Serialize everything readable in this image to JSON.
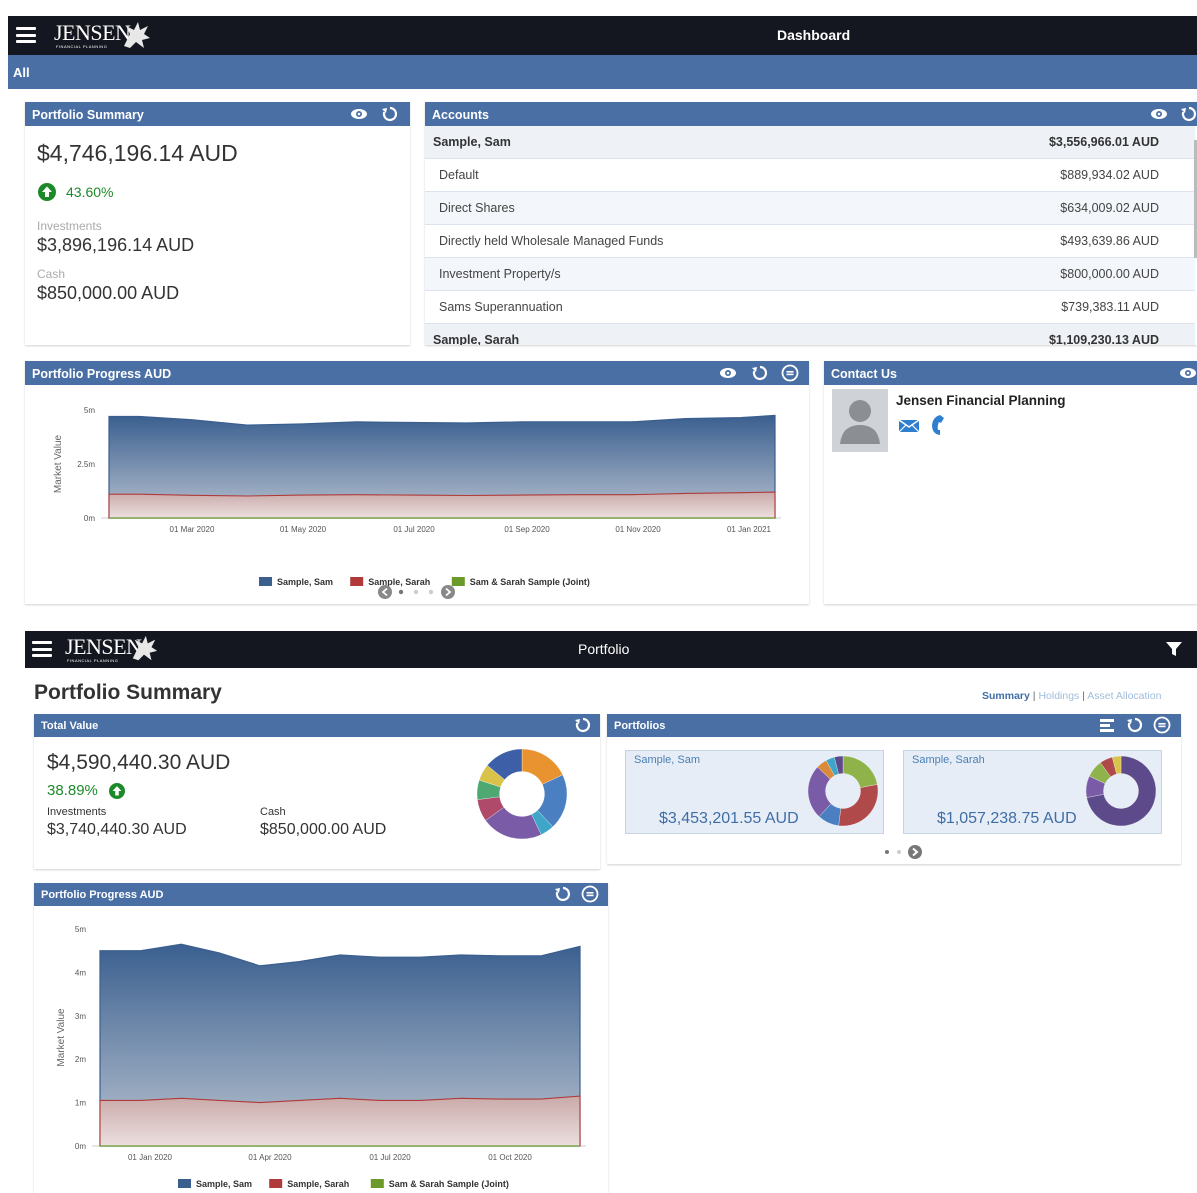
{
  "colors": {
    "topbar": "#14171f",
    "blue_bar": "#4a6fa5",
    "up_green": "#1d8a2a",
    "sam": "#3a5f8f",
    "sarah": "#b03a3a",
    "joint": "#6b9a2a"
  },
  "dashboard": {
    "logo": {
      "main": "JENSEN",
      "sub": "FINANCIAL PLANNING"
    },
    "title": "Dashboard",
    "filter_label": "All",
    "portfolio_summary": {
      "title": "Portfolio Summary",
      "total": "$4,746,196.14 AUD",
      "change": "43.60%",
      "investments_label": "Investments",
      "investments": "$3,896,196.14 AUD",
      "cash_label": "Cash",
      "cash": "$850,000.00 AUD"
    },
    "accounts": {
      "title": "Accounts",
      "rows": [
        {
          "name": "Sample, Sam",
          "value": "$3,556,966.01 AUD",
          "group": true
        },
        {
          "name": "Default",
          "value": "$889,934.02 AUD",
          "group": false
        },
        {
          "name": "Direct Shares",
          "value": "$634,009.02 AUD",
          "group": false
        },
        {
          "name": "Directly held Wholesale Managed Funds",
          "value": "$493,639.86 AUD",
          "group": false
        },
        {
          "name": "Investment Property/s",
          "value": "$800,000.00 AUD",
          "group": false
        },
        {
          "name": "Sams Superannuation",
          "value": "$739,383.11 AUD",
          "group": false
        },
        {
          "name": "Sample, Sarah",
          "value": "$1,109,230.13 AUD",
          "group": true
        }
      ]
    },
    "contact": {
      "title": "Contact Us",
      "name": "Jensen Financial Planning"
    },
    "chart_panel_title": "Portfolio Progress AUD"
  },
  "portfolio": {
    "title": "Portfolio",
    "page_title": "Portfolio Summary",
    "nav": {
      "summary": "Summary",
      "sep1": "|",
      "holdings": "Holdings",
      "sep2": "|",
      "allocation": "Asset Allocation"
    },
    "total_value": {
      "title": "Total Value",
      "total": "$4,590,440.30 AUD",
      "change": "38.89%",
      "investments_label": "Investments",
      "investments": "$3,740,440.30 AUD",
      "cash_label": "Cash",
      "cash": "$850,000.00 AUD"
    },
    "portfolios": {
      "title": "Portfolios",
      "cards": [
        {
          "name": "Sample, Sam",
          "value": "$3,453,201.55 AUD"
        },
        {
          "name": "Sample, Sarah",
          "value": "$1,057,238.75 AUD"
        }
      ]
    },
    "chart_panel_title": "Portfolio Progress AUD"
  },
  "chart_data": [
    {
      "type": "area",
      "ylabel": "Market Value",
      "xlabel": "",
      "yticks": [
        "0m",
        "2.5m",
        "5m"
      ],
      "ylim": [
        0,
        5
      ],
      "x_tick_labels": [
        "01 Mar 2020",
        "01 May 2020",
        "01 Jul 2020",
        "01 Sep 2020",
        "01 Nov 2020",
        "01 Jan 2021"
      ],
      "x": [
        "2020-01-15",
        "2020-02-01",
        "2020-03-01",
        "2020-04-01",
        "2020-05-01",
        "2020-06-01",
        "2020-07-01",
        "2020-08-01",
        "2020-09-01",
        "2020-10-01",
        "2020-11-01",
        "2020-12-01",
        "2021-01-01",
        "2021-01-20"
      ],
      "series": [
        {
          "name": "Sample, Sam",
          "values": [
            4.7,
            4.7,
            4.55,
            4.3,
            4.35,
            4.45,
            4.42,
            4.4,
            4.45,
            4.45,
            4.45,
            4.6,
            4.65,
            4.75
          ]
        },
        {
          "name": "Sample, Sarah",
          "values": [
            1.1,
            1.1,
            1.05,
            1.02,
            1.06,
            1.08,
            1.06,
            1.04,
            1.06,
            1.08,
            1.08,
            1.14,
            1.17,
            1.2
          ]
        },
        {
          "name": "Sam & Sarah Sample (Joint)",
          "values": [
            0,
            0,
            0,
            0,
            0,
            0,
            0,
            0,
            0,
            0,
            0,
            0,
            0,
            0
          ]
        }
      ],
      "legend": "bottom",
      "grid": false
    },
    {
      "type": "area",
      "ylabel": "Market Value",
      "xlabel": "",
      "yticks": [
        "0m",
        "1m",
        "2m",
        "3m",
        "4m",
        "5m"
      ],
      "ylim": [
        0,
        5
      ],
      "x_tick_labels": [
        "01 Jan 2020",
        "01 Apr 2020",
        "01 Jul 2020",
        "01 Oct 2020"
      ],
      "x": [
        "2019-12-01",
        "2020-01-01",
        "2020-02-01",
        "2020-03-01",
        "2020-04-01",
        "2020-05-01",
        "2020-06-01",
        "2020-07-01",
        "2020-08-01",
        "2020-09-01",
        "2020-10-01",
        "2020-11-01",
        "2020-12-01"
      ],
      "series": [
        {
          "name": "Sample, Sam",
          "values": [
            4.5,
            4.5,
            4.65,
            4.45,
            4.15,
            4.25,
            4.4,
            4.35,
            4.35,
            4.4,
            4.38,
            4.38,
            4.6
          ]
        },
        {
          "name": "Sample, Sarah",
          "values": [
            1.05,
            1.05,
            1.1,
            1.05,
            1.0,
            1.05,
            1.1,
            1.05,
            1.05,
            1.1,
            1.08,
            1.08,
            1.15
          ]
        },
        {
          "name": "Sam & Sarah Sample (Joint)",
          "values": [
            0,
            0,
            0,
            0,
            0,
            0,
            0,
            0,
            0,
            0,
            0,
            0,
            0
          ]
        }
      ],
      "legend": "bottom",
      "grid": false
    }
  ],
  "donuts": [
    {
      "colors": [
        "#e8932f",
        "#4a7fc1",
        "#3fa6c9",
        "#7a5ba8",
        "#b04a6b",
        "#4ea872",
        "#d9c24a",
        "#3d5fa8"
      ],
      "values": [
        18,
        20,
        5,
        22,
        8,
        7,
        6,
        14
      ]
    },
    {
      "colors": [
        "#8fb34a",
        "#b04a4a",
        "#4a7fc1",
        "#7a5ba8",
        "#d98a3a",
        "#3fa6c9",
        "#5d4a8a"
      ],
      "values": [
        22,
        30,
        10,
        25,
        5,
        4,
        4
      ]
    },
    {
      "colors": [
        "#5d4a8a",
        "#7a5ba8",
        "#8fb34a",
        "#b04a4a",
        "#d9c24a"
      ],
      "values": [
        72,
        10,
        8,
        6,
        4
      ]
    }
  ]
}
